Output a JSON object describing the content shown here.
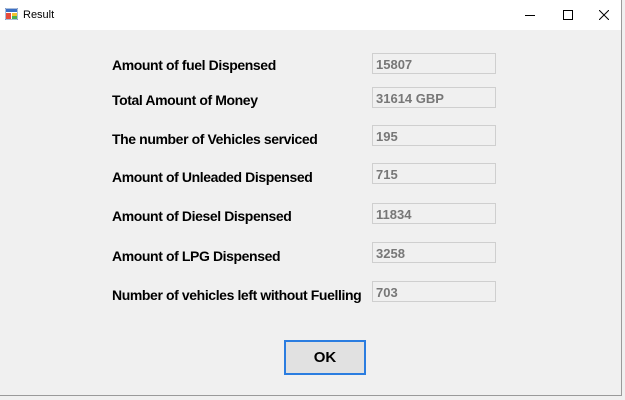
{
  "window": {
    "title": "Result"
  },
  "fields": [
    {
      "label": "Amount of fuel Dispensed",
      "value": "15807"
    },
    {
      "label": "Total Amount of Money",
      "value": "31614 GBP"
    },
    {
      "label": "The number of Vehicles serviced",
      "value": "195"
    },
    {
      "label": "Amount of Unleaded Dispensed",
      "value": "715"
    },
    {
      "label": "Amount of Diesel Dispensed",
      "value": "11834"
    },
    {
      "label": "Amount of LPG Dispensed",
      "value": "3258"
    },
    {
      "label": "Number of vehicles left without Fuelling",
      "value": "703"
    }
  ],
  "buttons": {
    "ok_label": "OK"
  },
  "colors": {
    "accent": "#2b7de0",
    "field_text": "#777777"
  }
}
